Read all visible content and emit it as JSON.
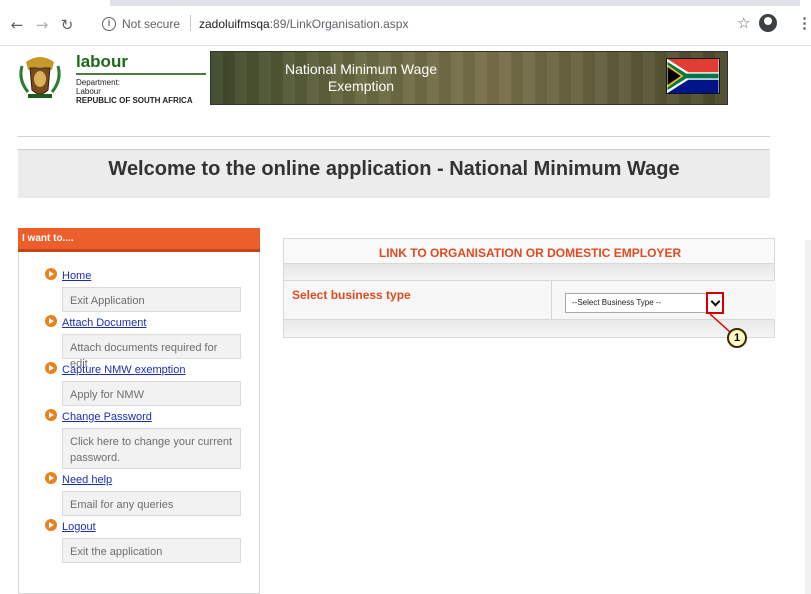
{
  "browser": {
    "url_security": "Not secure",
    "url_host": "zadoluifmsqa",
    "url_rest": ":89/LinkOrganisation.aspx"
  },
  "header": {
    "brand_name": "labour",
    "dept_line1": "Department:",
    "dept_line2": "Labour",
    "dept_line3": "REPUBLIC OF SOUTH AFRICA",
    "banner_line1": "National Minimum Wage",
    "banner_line2": "Exemption"
  },
  "welcome": "Welcome to the online application - National Minimum Wage",
  "sidebar": {
    "title": "I want to....",
    "items": [
      {
        "label": "Home",
        "desc": "Exit Application"
      },
      {
        "label": "Attach Document",
        "desc": "Attach documents required for edit"
      },
      {
        "label": "Capture NMW exemption",
        "desc": "Apply for NMW"
      },
      {
        "label": "Change Password",
        "desc": "Click here to change your current password."
      },
      {
        "label": "Need help",
        "desc": "Email for any queries"
      },
      {
        "label": "Logout",
        "desc": "Exit the application"
      }
    ]
  },
  "main": {
    "panel_title": "LINK TO ORGANISATION OR DOMESTIC EMPLOYER",
    "business_type_label": "Select business type",
    "business_type_selected": "--Select Business Type --"
  },
  "annotation": {
    "step": "1"
  },
  "colors": {
    "accent": "#e04a1f",
    "sidebar_header": "#ec5f2d",
    "link": "#1a2fb0",
    "callout_border": "#d40000"
  }
}
